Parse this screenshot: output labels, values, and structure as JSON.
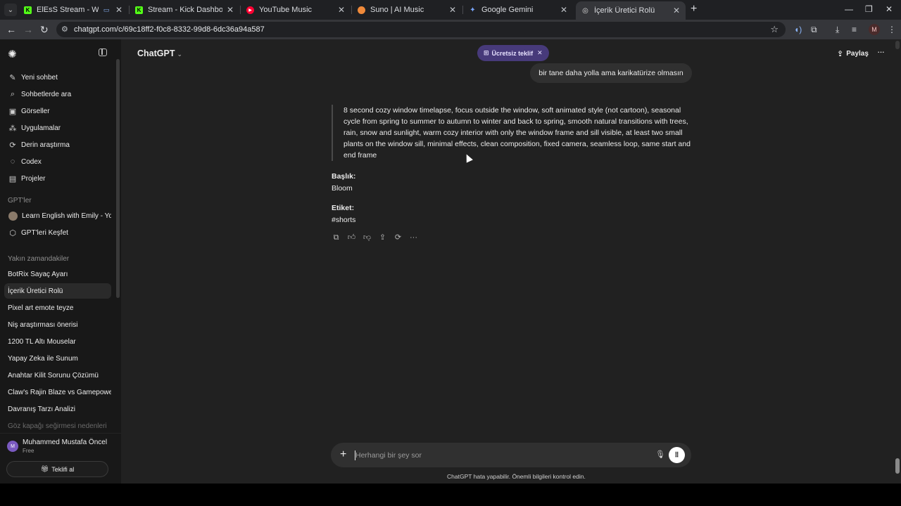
{
  "browser": {
    "tabs": [
      {
        "title": "ElEsS Stream - Watch Live",
        "favicon_color": "#53fc18",
        "favicon_char": "K"
      },
      {
        "title": "Stream - Kick Dashboard",
        "favicon_color": "#53fc18",
        "favicon_char": "K"
      },
      {
        "title": "YouTube Music",
        "favicon_color": "#ff0033",
        "favicon_char": "▶"
      },
      {
        "title": "Suno | AI Music",
        "favicon_color": "#f08a3a",
        "favicon_char": "●"
      },
      {
        "title": "Google Gemini",
        "favicon_color": "#7aa7ff",
        "favicon_char": "✦"
      },
      {
        "title": "İçerik Üretici Rolü",
        "favicon_color": "#dddddd",
        "favicon_char": "◎"
      }
    ],
    "url": "chatgpt.com/c/69c18ff2-f0c8-8332-99d8-6dc36a94a587",
    "profile_initial": "M"
  },
  "sidebar": {
    "primary": [
      {
        "label": "Yeni sohbet",
        "icon": "✎"
      },
      {
        "label": "Sohbetlerde ara",
        "icon": "⌕"
      },
      {
        "label": "Görseller",
        "icon": "▣"
      },
      {
        "label": "Uygulamalar",
        "icon": "⁂"
      },
      {
        "label": "Derin araştırma",
        "icon": "⟳"
      },
      {
        "label": "Codex",
        "icon": "◌"
      },
      {
        "label": "Projeler",
        "icon": "▤"
      }
    ],
    "gpts_heading": "GPT'ler",
    "gpts": [
      {
        "label": "Learn English with Emily - Yo..."
      },
      {
        "label": "GPT'leri Keşfet",
        "icon": "⬡"
      }
    ],
    "recent_heading": "Yakın zamandakiler",
    "recent": [
      "BotRix Sayaç Ayarı",
      "İçerik Üretici Rolü",
      "Pixel art emote teyze",
      "Niş araştırması önerisi",
      "1200 TL Altı Mouselar",
      "Yapay Zeka ile Sunum",
      "Anahtar Kilit Sorunu Çözümü",
      "Claw's Rajin Blaze vs Gamepowe...",
      "Davranış Tarzı Analizi"
    ],
    "faded_item": "Göz kapağı seğirmesi nedenleri",
    "user": {
      "name": "Muhammed Mustafa Öncel",
      "plan": "Free",
      "initial": "M",
      "offer": "Teklifi al"
    }
  },
  "header": {
    "model": "ChatGPT",
    "free_offer": "Ücretsiz teklif",
    "share": "Paylaş"
  },
  "conversation": {
    "user_message": "bir tane daha yolla ama karikatürize olmasın",
    "quote": "8 second cozy window timelapse, focus outside the window, soft animated style (not cartoon), seasonal cycle from spring to summer to autumn to winter and back to spring, smooth natural transitions with trees, rain, snow and sunlight, warm cozy interior with only the window frame and sill visible, at least two small plants on the window sill, minimal effects, clean composition, fixed camera, seamless loop, same start and end frame",
    "title_label": "Başlık:",
    "title_value": "Bloom",
    "tag_label": "Etiket:",
    "tag_value": "#shorts"
  },
  "composer": {
    "placeholder": "Herhangi bir şey sor",
    "disclaimer": "ChatGPT hata yapabilir. Önemli bilgileri kontrol edin."
  }
}
